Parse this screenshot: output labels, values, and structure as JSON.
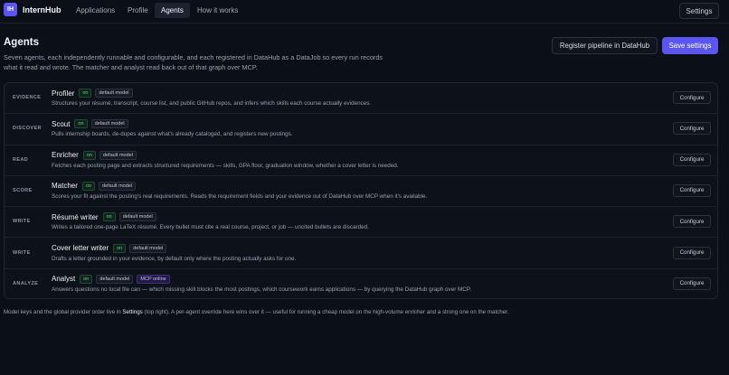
{
  "app": {
    "logo_text": "IH",
    "name": "InternHub"
  },
  "nav": {
    "tabs": [
      {
        "label": "Applications"
      },
      {
        "label": "Profile"
      },
      {
        "label": "Agents"
      },
      {
        "label": "How it works"
      }
    ],
    "active_tab": "Agents",
    "settings_label": "Settings"
  },
  "header": {
    "title": "Agents",
    "description": "Seven agents, each independently runnable and configurable, and each registered in DataHub as a DataJob so every run records what it read and wrote. The matcher and analyst read back out of that graph over MCP.",
    "register_label": "Register pipeline in DataHub",
    "save_label": "Save settings"
  },
  "agents": [
    {
      "stage": "EVIDENCE",
      "name": "Profiler",
      "status": "on",
      "model": "default model",
      "extra": "",
      "description": "Structures your résumé, transcript, course list, and public GitHub repos, and infers which skills each course actually evidences.",
      "action": "Configure"
    },
    {
      "stage": "DISCOVER",
      "name": "Scout",
      "status": "on",
      "model": "default model",
      "extra": "",
      "description": "Pulls internship boards, de-dupes against what's already cataloged, and registers new postings.",
      "action": "Configure"
    },
    {
      "stage": "READ",
      "name": "Enricher",
      "status": "on",
      "model": "default model",
      "extra": "",
      "description": "Fetches each posting page and extracts structured requirements — skills, GPA floor, graduation window, whether a cover letter is needed.",
      "action": "Configure"
    },
    {
      "stage": "SCORE",
      "name": "Matcher",
      "status": "on",
      "model": "default model",
      "extra": "",
      "description": "Scores your fit against the posting's real requirements. Reads the requirement fields and your evidence out of DataHub over MCP when it's available.",
      "action": "Configure"
    },
    {
      "stage": "WRITE",
      "name": "Résumé writer",
      "status": "on",
      "model": "default model",
      "extra": "",
      "description": "Writes a tailored one-page LaTeX résumé. Every bullet must cite a real course, project, or job — uncited bullets are discarded.",
      "action": "Configure"
    },
    {
      "stage": "WRITE",
      "name": "Cover letter writer",
      "status": "on",
      "model": "default model",
      "extra": "",
      "description": "Drafts a letter grounded in your evidence, by default only where the posting actually asks for one.",
      "action": "Configure"
    },
    {
      "stage": "ANALYZE",
      "name": "Analyst",
      "status": "on",
      "model": "default model",
      "extra": "MCP online",
      "description": "Answers questions no local file can — which missing skill blocks the most postings, which coursework earns applications — by querying the DataHub graph over MCP.",
      "action": "Configure"
    }
  ],
  "footnote": {
    "before": "Model keys and the global provider order live in ",
    "link": "Settings",
    "after": " (top right). A per-agent override here wins over it — useful for running a cheap model on the high-volume enricher and a strong one on the matcher."
  }
}
